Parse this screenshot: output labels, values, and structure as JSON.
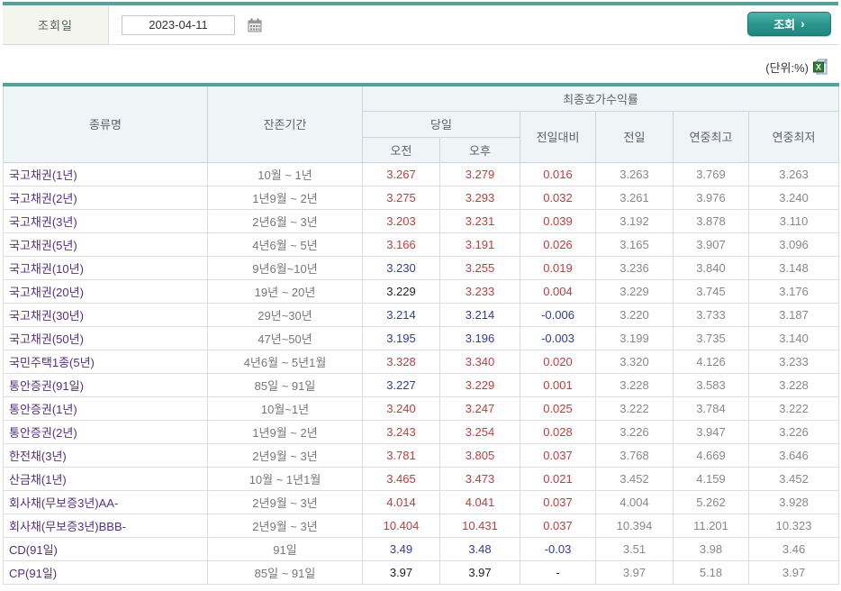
{
  "query": {
    "label": "조회일",
    "date_value": "2023-04-11",
    "search_label": "조회",
    "search_chevron": "›"
  },
  "units_label": "(단위:%)",
  "colors": {
    "accent_teal": "#55a29a",
    "button_teal": "#2a948c",
    "up_red": "#c43b3b",
    "down_blue": "#3339a8",
    "flat_black": "#222222",
    "bond_name_purple": "#53307e",
    "header_bg": "#eff4f6"
  },
  "icons": {
    "calendar": "calendar-icon",
    "excel": "excel-icon"
  },
  "table": {
    "headers": {
      "type": "종류명",
      "maturity": "잔존기간",
      "final_yield": "최종호가수익률",
      "today": "당일",
      "am": "오전",
      "pm": "오후",
      "vs_prev": "전일대비",
      "prev": "전일",
      "year_high": "연중최고",
      "year_low": "연중최저"
    },
    "rows": [
      {
        "name": "국고채권(1년)",
        "period": "10월 ~ 1년",
        "am": "3.267",
        "pm": "3.279",
        "chg": "0.016",
        "prev": "3.263",
        "high": "3.769",
        "low": "3.263",
        "t": [
          "up",
          "up",
          "up"
        ]
      },
      {
        "name": "국고채권(2년)",
        "period": "1년9월 ~ 2년",
        "am": "3.275",
        "pm": "3.293",
        "chg": "0.032",
        "prev": "3.261",
        "high": "3.976",
        "low": "3.240",
        "t": [
          "up",
          "up",
          "up"
        ]
      },
      {
        "name": "국고채권(3년)",
        "period": "2년6월 ~ 3년",
        "am": "3.203",
        "pm": "3.231",
        "chg": "0.039",
        "prev": "3.192",
        "high": "3.878",
        "low": "3.110",
        "t": [
          "up",
          "up",
          "up"
        ]
      },
      {
        "name": "국고채권(5년)",
        "period": "4년6월 ~ 5년",
        "am": "3.166",
        "pm": "3.191",
        "chg": "0.026",
        "prev": "3.165",
        "high": "3.907",
        "low": "3.096",
        "t": [
          "up",
          "up",
          "up"
        ]
      },
      {
        "name": "국고채권(10년)",
        "period": "9년6월~10년",
        "am": "3.230",
        "pm": "3.255",
        "chg": "0.019",
        "prev": "3.236",
        "high": "3.840",
        "low": "3.148",
        "t": [
          "down",
          "up",
          "up"
        ]
      },
      {
        "name": "국고채권(20년)",
        "period": "19년 ~ 20년",
        "am": "3.229",
        "pm": "3.233",
        "chg": "0.004",
        "prev": "3.229",
        "high": "3.745",
        "low": "3.176",
        "t": [
          "flat",
          "up",
          "up"
        ]
      },
      {
        "name": "국고채권(30년)",
        "period": "29년~30년",
        "am": "3.214",
        "pm": "3.214",
        "chg": "-0.006",
        "prev": "3.220",
        "high": "3.733",
        "low": "3.187",
        "t": [
          "down",
          "down",
          "down"
        ]
      },
      {
        "name": "국고채권(50년)",
        "period": "47년~50년",
        "am": "3.195",
        "pm": "3.196",
        "chg": "-0.003",
        "prev": "3.199",
        "high": "3.735",
        "low": "3.140",
        "t": [
          "down",
          "down",
          "down"
        ]
      },
      {
        "name": "국민주택1종(5년)",
        "period": "4년6월 ~ 5년1월",
        "am": "3.328",
        "pm": "3.340",
        "chg": "0.020",
        "prev": "3.320",
        "high": "4.126",
        "low": "3.233",
        "t": [
          "up",
          "up",
          "up"
        ]
      },
      {
        "name": "통안증권(91일)",
        "period": "85일 ~ 91일",
        "am": "3.227",
        "pm": "3.229",
        "chg": "0.001",
        "prev": "3.228",
        "high": "3.583",
        "low": "3.228",
        "t": [
          "down",
          "up",
          "up"
        ]
      },
      {
        "name": "통안증권(1년)",
        "period": "10월~1년",
        "am": "3.240",
        "pm": "3.247",
        "chg": "0.025",
        "prev": "3.222",
        "high": "3.784",
        "low": "3.222",
        "t": [
          "up",
          "up",
          "up"
        ]
      },
      {
        "name": "통안증권(2년)",
        "period": "1년9월 ~ 2년",
        "am": "3.243",
        "pm": "3.254",
        "chg": "0.028",
        "prev": "3.226",
        "high": "3.947",
        "low": "3.226",
        "t": [
          "up",
          "up",
          "up"
        ]
      },
      {
        "name": "한전채(3년)",
        "period": "2년9월 ~ 3년",
        "am": "3.781",
        "pm": "3.805",
        "chg": "0.037",
        "prev": "3.768",
        "high": "4.669",
        "low": "3.646",
        "t": [
          "up",
          "up",
          "up"
        ]
      },
      {
        "name": "산금채(1년)",
        "period": "10월 ~ 1년1월",
        "am": "3.465",
        "pm": "3.473",
        "chg": "0.021",
        "prev": "3.452",
        "high": "4.159",
        "low": "3.452",
        "t": [
          "up",
          "up",
          "up"
        ]
      },
      {
        "name": "회사채(무보증3년)AA-",
        "period": "2년9월 ~ 3년",
        "am": "4.014",
        "pm": "4.041",
        "chg": "0.037",
        "prev": "4.004",
        "high": "5.262",
        "low": "3.928",
        "t": [
          "up",
          "up",
          "up"
        ]
      },
      {
        "name": "회사채(무보증3년)BBB-",
        "period": "2년9월 ~ 3년",
        "am": "10.404",
        "pm": "10.431",
        "chg": "0.037",
        "prev": "10.394",
        "high": "11.201",
        "low": "10.323",
        "t": [
          "up",
          "up",
          "up"
        ]
      },
      {
        "name": "CD(91일)",
        "period": "91일",
        "am": "3.49",
        "pm": "3.48",
        "chg": "-0.03",
        "prev": "3.51",
        "high": "3.98",
        "low": "3.46",
        "t": [
          "down",
          "down",
          "down"
        ]
      },
      {
        "name": "CP(91일)",
        "period": "85일 ~ 91일",
        "am": "3.97",
        "pm": "3.97",
        "chg": "-",
        "prev": "3.97",
        "high": "5.18",
        "low": "3.97",
        "t": [
          "flat",
          "flat",
          "flat"
        ]
      }
    ]
  }
}
